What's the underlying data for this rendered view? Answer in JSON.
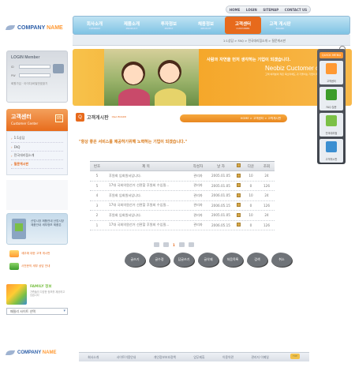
{
  "top_links": [
    "HOME",
    "LOGIN",
    "SITEMAP",
    "CONTACT US"
  ],
  "logo": {
    "word1": "COMPANY",
    "word2": "NAME"
  },
  "nav": [
    {
      "label": "회사소개",
      "sub": "COMPANY"
    },
    {
      "label": "제품소개",
      "sub": "PRODUCT"
    },
    {
      "label": "투자정보",
      "sub": "INVEST"
    },
    {
      "label": "채용정보",
      "sub": "RECRUIT"
    },
    {
      "label": "고객센터",
      "sub": "CUSTOMER"
    },
    {
      "label": "고객 게시판",
      "sub": "BOARD"
    }
  ],
  "subnav_crumb": "1:1상담 > FAQ > 전국대리점소개 > 질문게시판",
  "login": {
    "title": "LOGIN Member",
    "id_label": "ID",
    "pw_label": "PW",
    "join": "회원가입 · 아이디/비밀번호찾기"
  },
  "side_header": {
    "kr": "고객센터",
    "en": "Customer Center",
    "badge": "05"
  },
  "side_menu": [
    "1:1상담",
    "FAQ",
    "전국대리점소개",
    "질문게시판"
  ],
  "promo": {
    "text": "산업시장 제품안내 산업시장 제품안내 세부정보 제품은"
  },
  "promo_links": [
    "세무에 대한 고객 게시판",
    "사전문의 세부 상담 안내"
  ],
  "family": {
    "title": "FAMILY 정보",
    "desc": "가족들의 다양한 정보를 제공하고 있습니다"
  },
  "family_select": "패밀리 사이트 선택",
  "banner": {
    "msg": "사람과 자연을 먼저 생각하는 기업이 되겠습니다.",
    "neo": "Neobiz Cuctomer center",
    "tiny": "고객 여러분의 작은 목소리에도 귀 기울이는 기업이 되겠습니다"
  },
  "content": {
    "title": "고객게시판",
    "title_en": "Q&A BOARD",
    "badge": "Q",
    "path": "HOME > 고객센터 > 고객게시판",
    "intro": "\"항상 좋은 서비스를 제공하기위해 노력하는 기업이 되겠습니다.\""
  },
  "table": {
    "headers": [
      "번호",
      "제 목",
      "작성자",
      "날 자",
      "",
      "다운",
      "조회"
    ],
    "rows": [
      [
        "5",
        "후원회 입회원서입니다.",
        "관리자",
        "2005.01.05",
        "",
        "10",
        "24"
      ],
      [
        "5",
        "17대 국회의원선거 선관할 후원회 수입필...",
        "관리자",
        "2005.01.05",
        "",
        "0",
        "126"
      ],
      [
        "4",
        "후원회 입회원서입니다.",
        "관리자",
        "2006.01.05",
        "",
        "10",
        "24"
      ],
      [
        "3",
        "17대 국회의원선거 선관할 후원회 수입필...",
        "관리자",
        "2006.05.15",
        "",
        "0",
        "126"
      ],
      [
        "2",
        "후원회 입회원서입니다.",
        "관리자",
        "2005.01.05",
        "",
        "10",
        "24"
      ],
      [
        "1",
        "17대 국회의원선거 선관할 후원회 수입필...",
        "관리자",
        "2006.05.15",
        "",
        "0",
        "126"
      ]
    ]
  },
  "pager": {
    "pages": [
      "1"
    ]
  },
  "blob_buttons": [
    "글쓰기",
    "글수정",
    "답글쓰기",
    "글삭제",
    "처음목록",
    "검색",
    "취소"
  ],
  "quick": {
    "title": "QUICK MENU",
    "items": [
      {
        "label": "고객센터",
        "color": "#ff9933"
      },
      {
        "label": "FAQ 질문",
        "color": "#3c9c2a"
      },
      {
        "label": "전국대리점",
        "color": "#7bc046"
      },
      {
        "label": "고객게시판",
        "color": "#3c8fd1"
      }
    ]
  },
  "footer": {
    "links": [
      "회사소개",
      "사이트이용안내",
      "개인정보보호정책",
      "업무제휴",
      "이용약관",
      "관리자 이메일"
    ],
    "top": "TOP"
  },
  "colors": {
    "accent": "#e76a1c",
    "nav": "#7fc3e4"
  }
}
